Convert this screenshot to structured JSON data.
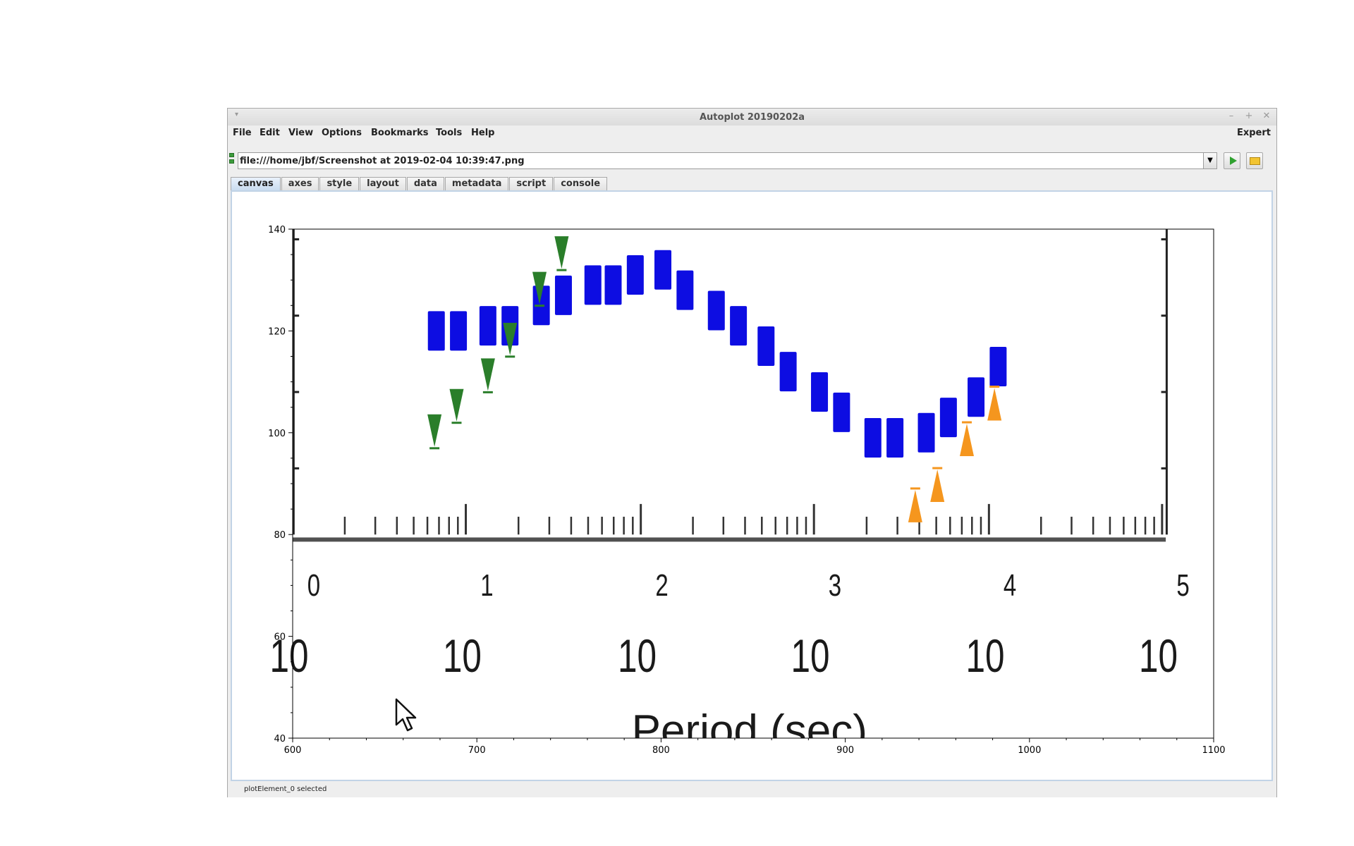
{
  "window": {
    "title": "Autoplot 20190202a"
  },
  "menubar": {
    "items": [
      "File",
      "Edit",
      "View",
      "Options",
      "Bookmarks",
      "Tools",
      "Help"
    ],
    "expert_label": "Expert"
  },
  "urlbar": {
    "value": "file:///home/jbf/Screenshot at 2019-02-04 10:39:47.png"
  },
  "tabs": [
    "canvas",
    "axes",
    "style",
    "layout",
    "data",
    "metadata",
    "script",
    "console"
  ],
  "active_tab": "canvas",
  "status": {
    "text": "plotElement_0 selected"
  },
  "chart_data": {
    "type": "image",
    "x_axis": {
      "range": [
        600,
        1100
      ],
      "tick_labels": [
        "600",
        "700",
        "800",
        "900",
        "1000",
        "1100"
      ]
    },
    "y_axis": {
      "range": [
        40,
        140
      ],
      "tick_labels": [
        "40",
        "60",
        "80",
        "100",
        "120",
        "140"
      ]
    },
    "embedded_image": {
      "xlabel": "Period (sec)",
      "x_tick_labels": [
        "10",
        "10",
        "10",
        "10",
        "10",
        "10"
      ],
      "x_tick_exponents": [
        "0",
        "1",
        "2",
        "3",
        "4",
        "5"
      ],
      "series": [
        {
          "color": "#0000e0",
          "marker": "square",
          "values": [
            [
              678,
              120
            ],
            [
              690,
              120
            ],
            [
              706,
              121
            ],
            [
              718,
              121
            ],
            [
              735,
              125
            ],
            [
              747,
              127
            ],
            [
              763,
              129
            ],
            [
              774,
              129
            ],
            [
              786,
              131
            ],
            [
              801,
              132
            ],
            [
              813,
              128
            ],
            [
              830,
              124
            ],
            [
              842,
              121
            ],
            [
              857,
              117
            ],
            [
              869,
              112
            ],
            [
              886,
              108
            ],
            [
              898,
              104
            ],
            [
              915,
              99
            ],
            [
              927,
              99
            ],
            [
              944,
              100
            ],
            [
              956,
              103
            ],
            [
              971,
              107
            ],
            [
              983,
              113
            ]
          ]
        },
        {
          "color": "#2a7e2a",
          "marker": "down-triangle",
          "values": [
            [
              677,
              100
            ],
            [
              689,
              105
            ],
            [
              706,
              111
            ],
            [
              718,
              118
            ],
            [
              734,
              128
            ],
            [
              746,
              135
            ]
          ]
        },
        {
          "color": "#f5961e",
          "marker": "up-triangle",
          "values": [
            [
              938,
              86
            ],
            [
              950,
              90
            ],
            [
              966,
              99
            ],
            [
              981,
              106
            ]
          ]
        }
      ]
    }
  }
}
